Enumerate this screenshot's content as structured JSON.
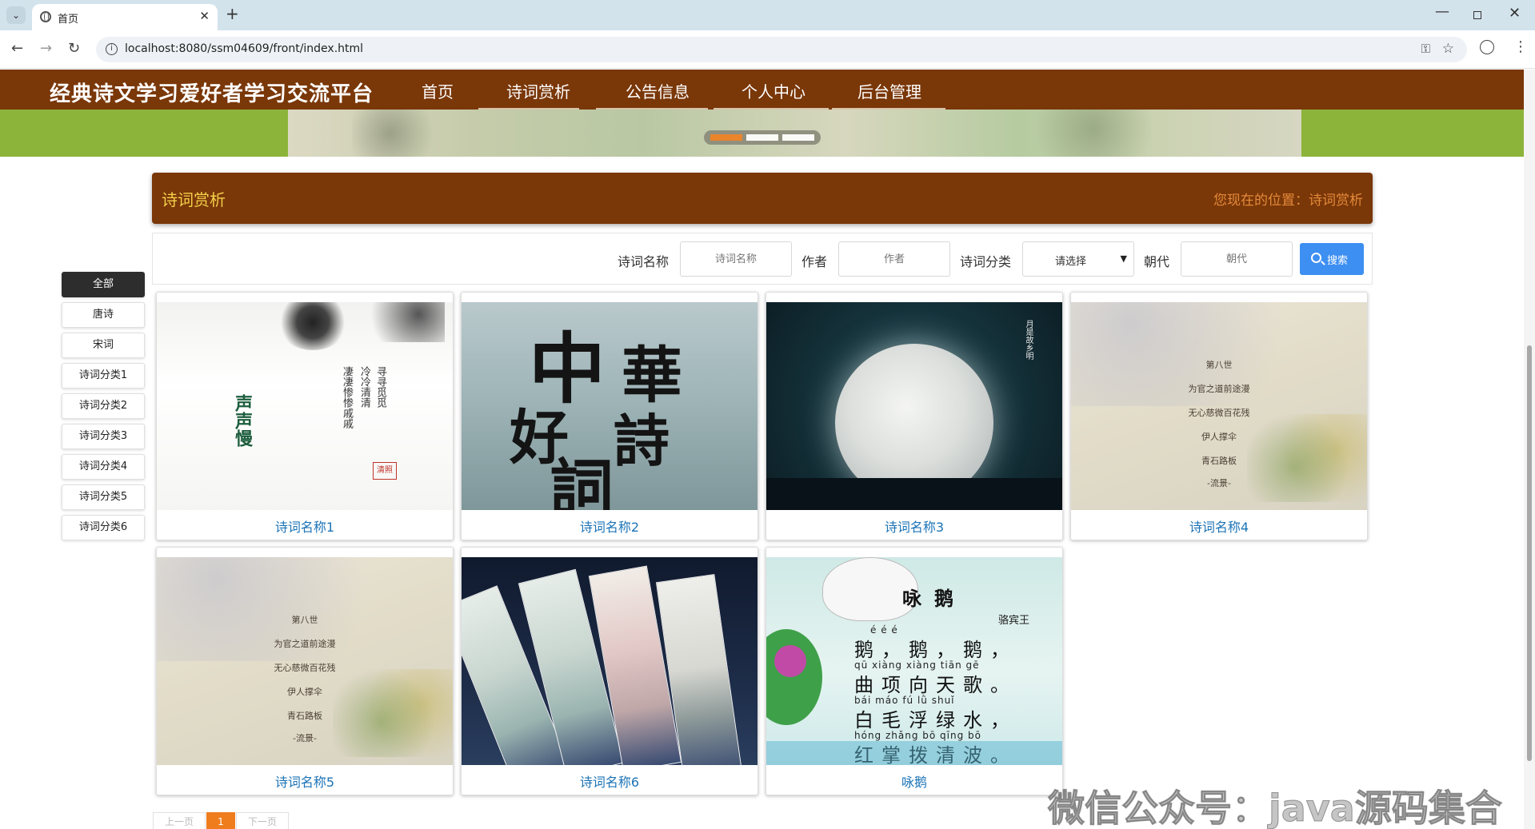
{
  "browser": {
    "tab_title": "首页",
    "tab_close": "✕",
    "new_tab": "+",
    "url": "localhost:8080/ssm04609/front/index.html",
    "icons": [
      "tab-menu-icon",
      "globe-icon",
      "back-icon",
      "forward-icon",
      "reload-icon",
      "site-info-icon",
      "password-key-icon",
      "bookmark-star-icon",
      "profile-icon",
      "menu-kebab-icon"
    ]
  },
  "header": {
    "site_title": "经典诗文学习爱好者学习交流平台",
    "nav": [
      "首页",
      "诗词赏析",
      "公告信息",
      "个人中心",
      "后台管理"
    ]
  },
  "banner": {
    "slides": 3,
    "active_slide": 1,
    "accent_color": "#ef7d1e"
  },
  "section": {
    "title": "诗词赏析",
    "location": "您现在的位置：诗词赏析"
  },
  "search": {
    "name_label": "诗词名称",
    "name_placeholder": "诗词名称",
    "author_label": "作者",
    "author_placeholder": "作者",
    "category_label": "诗词分类",
    "category_value": "请选择",
    "dynasty_label": "朝代",
    "dynasty_placeholder": "朝代",
    "button_label": "搜索"
  },
  "categories": [
    "全部",
    "唐诗",
    "宋词",
    "诗词分类1",
    "诗词分类2",
    "诗词分类3",
    "诗词分类4",
    "诗词分类5",
    "诗词分类6"
  ],
  "active_category": "全部",
  "cards": [
    {
      "name": "诗词名称1",
      "art": {
        "green": "声声慢",
        "poem_cols": [
          "寻寻觅觅",
          "冷冷清清",
          "凄凄惨惨戚戚"
        ],
        "seal": "清照"
      }
    },
    {
      "name": "诗词名称2",
      "art": {
        "calligraphy": [
          "中",
          "華",
          "好",
          "詩",
          "詞"
        ]
      }
    },
    {
      "name": "诗词名称3",
      "art": {
        "vertical": "月是故乡明"
      }
    },
    {
      "name": "诗词名称4",
      "art": {
        "lines": [
          "第八世",
          "为官之道前途漫",
          "无心慈微百花残",
          "伊人撑伞",
          "青石路板",
          "-流景-"
        ]
      }
    },
    {
      "name": "诗词名称5",
      "art": {
        "lines": [
          "第八世",
          "为官之道前途漫",
          "无心慈微百花残",
          "伊人撑伞",
          "青石路板",
          "-流景-"
        ]
      }
    },
    {
      "name": "诗词名称6"
    },
    {
      "name": "咏鹅",
      "art": {
        "title": "咏鹅",
        "author": "骆宾王",
        "pinyin": [
          "é    é    é",
          "qū  xiàng xiàng  tiān  gē",
          "bái  máo   fú    lǜ   shuǐ",
          "hóng zhǎng  bō   qīng   bō"
        ],
        "lines": [
          "鹅，鹅，鹅，",
          "曲项向天歌。",
          "白毛浮绿水，",
          "红掌拨清波。"
        ]
      }
    }
  ],
  "pagination": {
    "prev": "上一页",
    "current": "1",
    "next": "下一页"
  },
  "watermark": "微信公众号：java源码集合"
}
